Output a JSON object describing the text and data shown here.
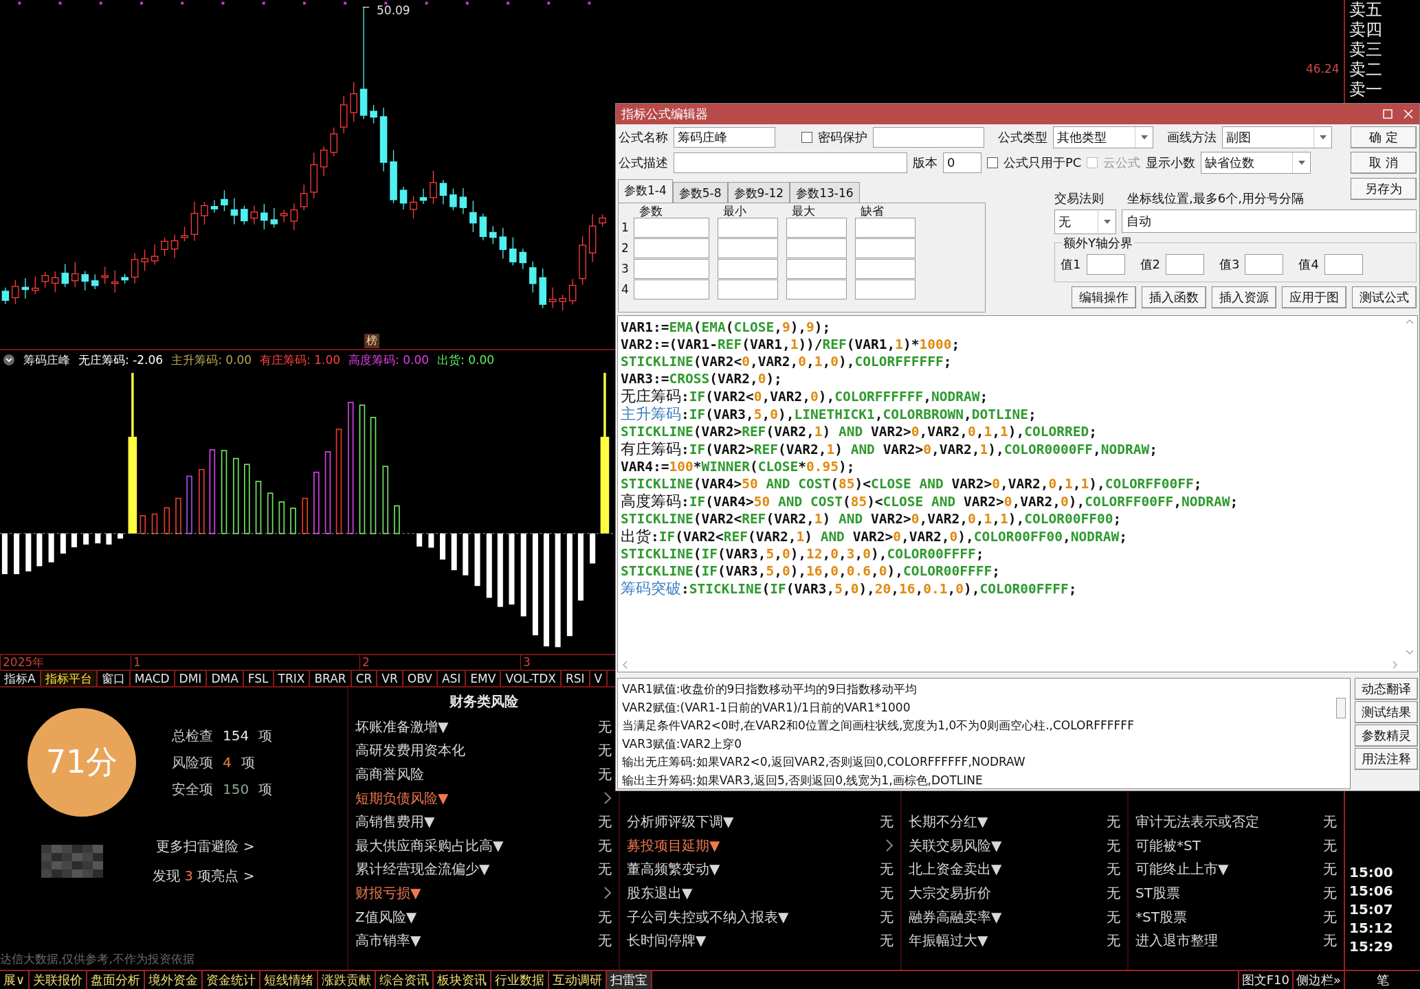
{
  "price_chart": {
    "high_label": "50.09",
    "price_label": "46.24",
    "marker": "榜"
  },
  "order_book": {
    "labels": [
      "卖五",
      "卖四",
      "卖三",
      "卖二",
      "卖一"
    ]
  },
  "indicator": {
    "name": "筹码庄峰",
    "values": [
      {
        "text": "无庄筹码: -2.06",
        "color": "#ffffff"
      },
      {
        "text": "主升筹码: 0.00",
        "color": "#b8a858"
      },
      {
        "text": "有庄筹码: 1.00",
        "color": "#ff4040"
      },
      {
        "text": "高度筹码: 0.00",
        "color": "#e040e8"
      },
      {
        "text": "出货: 0.00",
        "color": "#60f060"
      }
    ]
  },
  "time_axis": [
    "2025年",
    "1",
    "2",
    "3"
  ],
  "indicator_tabs": [
    {
      "label": "指标A",
      "selected": false
    },
    {
      "label": "指标平台",
      "selected": true
    },
    {
      "label": "窗口",
      "selected": false
    },
    {
      "label": "MACD",
      "selected": false
    },
    {
      "label": "DMI",
      "selected": false
    },
    {
      "label": "DMA",
      "selected": false
    },
    {
      "label": "FSL",
      "selected": false
    },
    {
      "label": "TRIX",
      "selected": false
    },
    {
      "label": "BRAR",
      "selected": false
    },
    {
      "label": "CR",
      "selected": false
    },
    {
      "label": "VR",
      "selected": false
    },
    {
      "label": "OBV",
      "selected": false
    },
    {
      "label": "ASI",
      "selected": false
    },
    {
      "label": "EMV",
      "selected": false
    },
    {
      "label": "VOL-TDX",
      "selected": false
    },
    {
      "label": "RSI",
      "selected": false
    },
    {
      "label": "V",
      "selected": false
    }
  ],
  "risk_summary": {
    "score": "71分",
    "stats": [
      {
        "label": "总检查",
        "count": "154",
        "unit": "项",
        "color": "#e8e8e8"
      },
      {
        "label": "风险项",
        "count": "4",
        "unit": "项",
        "color": "#f08040"
      },
      {
        "label": "安全项",
        "count": "150",
        "unit": "项",
        "color": "#8aa890"
      }
    ],
    "more_link": "更多扫雷避险 >",
    "highlights": {
      "before": "发现",
      "count": "3",
      "after": "项亮点 >"
    },
    "disclaimer": "达信大数据,仅供参考,不作为投资依据"
  },
  "risk_columns": [
    {
      "title": "财务类风险",
      "rows": [
        {
          "label": "坏账准备激增▼",
          "kind": "value",
          "value": "无"
        },
        {
          "label": "高研发费用资本化",
          "kind": "value",
          "value": "无"
        },
        {
          "label": "高商誉风险",
          "kind": "value",
          "value": "无"
        },
        {
          "label": "短期负债风险▼",
          "kind": "alert"
        },
        {
          "label": "高销售费用▼",
          "kind": "value",
          "value": "无"
        },
        {
          "label": "最大供应商采购占比高▼",
          "kind": "value",
          "value": "无"
        },
        {
          "label": "累计经营现金流偏少▼",
          "kind": "value",
          "value": "无"
        },
        {
          "label": "财报亏损▼",
          "kind": "alert"
        },
        {
          "label": "Z值风险▼",
          "kind": "value",
          "value": "无"
        },
        {
          "label": "高市销率▼",
          "kind": "value",
          "value": "无"
        }
      ]
    },
    {
      "rows": [
        {
          "label": "分析师评级下调▼",
          "kind": "value",
          "value": "无"
        },
        {
          "label": "募投项目延期▼",
          "kind": "alert"
        },
        {
          "label": "董高频繁变动▼",
          "kind": "value",
          "value": "无"
        },
        {
          "label": "股东退出▼",
          "kind": "value",
          "value": "无"
        },
        {
          "label": "子公司失控或不纳入报表▼",
          "kind": "value",
          "value": "无"
        },
        {
          "label": "长时间停牌▼",
          "kind": "value",
          "value": "无"
        }
      ]
    },
    {
      "rows": [
        {
          "label": "长期不分红▼",
          "kind": "value",
          "value": "无"
        },
        {
          "label": "关联交易风险▼",
          "kind": "value",
          "value": "无"
        },
        {
          "label": "北上资金卖出▼",
          "kind": "value",
          "value": "无"
        },
        {
          "label": "大宗交易折价",
          "kind": "value",
          "value": "无"
        },
        {
          "label": "融券高融卖率▼",
          "kind": "value",
          "value": "无"
        },
        {
          "label": "年振幅过大▼",
          "kind": "value",
          "value": "无"
        }
      ]
    },
    {
      "rows": [
        {
          "label": "审计无法表示或否定",
          "kind": "value",
          "value": "无"
        },
        {
          "label": "可能被*ST",
          "kind": "value",
          "value": "无"
        },
        {
          "label": "可能终止上市▼",
          "kind": "value",
          "value": "无"
        },
        {
          "label": "ST股票",
          "kind": "value",
          "value": "无"
        },
        {
          "label": "*ST股票",
          "kind": "value",
          "value": "无"
        },
        {
          "label": "进入退市整理",
          "kind": "value",
          "value": "无"
        }
      ]
    }
  ],
  "times": [
    "15:00",
    "15:06",
    "15:07",
    "15:12",
    "15:29"
  ],
  "bottom_tabs": [
    {
      "label": "展∨",
      "selected": false
    },
    {
      "label": "关联报价",
      "selected": false
    },
    {
      "label": "盘面分析",
      "selected": false
    },
    {
      "label": "境外资金",
      "selected": false
    },
    {
      "label": "资金统计",
      "selected": false
    },
    {
      "label": "短线情绪",
      "selected": false
    },
    {
      "label": "涨跌贡献",
      "selected": false
    },
    {
      "label": "综合资讯",
      "selected": false
    },
    {
      "label": "板块资讯",
      "selected": false
    },
    {
      "label": "行业数据",
      "selected": false
    },
    {
      "label": "互动调研",
      "selected": false
    },
    {
      "label": "扫雷宝",
      "selected": true
    }
  ],
  "bottom_right": [
    "图文F10",
    "侧边栏»"
  ],
  "pen_label": "笔",
  "editor": {
    "title": "指标公式编辑器",
    "name_label": "公式名称",
    "name_value": "筹码庄峰",
    "password": {
      "label": "密码保护",
      "checked": false,
      "disabled": false
    },
    "type_label": "公式类型",
    "type_value": "其他类型",
    "draw_label": "画线方法",
    "draw_value": "副图",
    "desc_label": "公式描述",
    "version_label": "版本",
    "version_value": "0",
    "pc_only": {
      "label": "公式只用于PC",
      "checked": false,
      "disabled": false
    },
    "cloud": {
      "label": "云公式",
      "checked": false,
      "disabled": true
    },
    "decimals_label": "显示小数",
    "decimals_value": "缺省位数",
    "side_buttons": [
      "确  定",
      "取  消",
      "另存为"
    ],
    "param_tabs": [
      {
        "label": "参数1-4",
        "selected": true
      },
      {
        "label": "参数5-8",
        "selected": false
      },
      {
        "label": "参数9-12",
        "selected": false
      },
      {
        "label": "参数13-16",
        "selected": false
      }
    ],
    "param_headers": [
      "参数",
      "最小",
      "最大",
      "缺省"
    ],
    "param_rows": [
      "1",
      "2",
      "3",
      "4"
    ],
    "trade_label": "交易法则",
    "trade_value": "无",
    "axis_label": "坐标线位置,最多6个,用分号分隔",
    "axis_value": "自动",
    "y_group": "额外Y轴分界",
    "y_values": [
      "值1",
      "值2",
      "值3",
      "值4"
    ],
    "actions": [
      "编辑操作",
      "插入函数",
      "插入资源",
      "应用于图",
      "测试公式"
    ],
    "code_lines": [
      {
        "body": "VAR1:=EMA(EMA(CLOSE,9),9);"
      },
      {
        "body": "VAR2:=(VAR1-REF(VAR1,1))/REF(VAR1,1)*1000;"
      },
      {
        "body": "STICKLINE(VAR2<0,VAR2,0,1,0),COLORFFFFFF;"
      },
      {
        "body": "VAR3:=CROSS(VAR2,0);"
      },
      {
        "name": "无庄筹码",
        "body": ":IF(VAR2<0,VAR2,0),COLORFFFFFF,NODRAW;"
      },
      {
        "name": "主升筹码",
        "color": "#3a7fc0",
        "body": ":IF(VAR3,5,0),LINETHICK1,COLORBROWN,DOTLINE;"
      },
      {
        "body": "STICKLINE(VAR2>REF(VAR2,1) AND VAR2>0,VAR2,0,1,1),COLORRED;"
      },
      {
        "name": "有庄筹码",
        "body": ":IF(VAR2>REF(VAR2,1) AND VAR2>0,VAR2,1),COLOR0000FF,NODRAW;"
      },
      {
        "body": "VAR4:=100*WINNER(CLOSE*0.95);"
      },
      {
        "body": "STICKLINE(VAR4>50 AND COST(85)<CLOSE AND VAR2>0,VAR2,0,1,1),COLORFF00FF;"
      },
      {
        "name": "高度筹码",
        "body": ":IF(VAR4>50 AND COST(85)<CLOSE AND VAR2>0,VAR2,0),COLORFF00FF,NODRAW;"
      },
      {
        "body": "STICKLINE(VAR2<REF(VAR2,1) AND VAR2>0,VAR2,0,1,1),COLOR00FF00;"
      },
      {
        "name": "出货",
        "body": ":IF(VAR2<REF(VAR2,1) AND VAR2>0,VAR2,0),COLOR00FF00,NODRAW;"
      },
      {
        "body": "STICKLINE(IF(VAR3,5,0),12,0,3,0),COLOR00FFFF;"
      },
      {
        "body": "STICKLINE(IF(VAR3,5,0),16,0,0.6,0),COLOR00FFFF;"
      },
      {
        "name": "筹码突破",
        "color": "#3a7fc0",
        "body": ":STICKLINE(IF(VAR3,5,0),20,16,0.1,0),COLOR00FFFF;"
      }
    ],
    "notes": [
      "VAR1赋值:收盘价的9日指数移动平均的9日指数移动平均",
      "VAR2赋值:(VAR1-1日前的VAR1)/1日前的VAR1*1000",
      "当满足条件VAR2<0时,在VAR2和0位置之间画柱状线,宽度为1,0不为0则画空心柱.,COLORFFFFFF",
      "VAR3赋值:VAR2上穿0",
      "输出无庄筹码:如果VAR2<0,返回VAR2,否则返回0,COLORFFFFFF,NODRAW",
      "输出主升筹码:如果VAR3,返回5,否则返回0,线宽为1,画棕色,DOTLINE"
    ],
    "note_buttons": [
      "动态翻译",
      "测试结果",
      "参数精灵",
      "用法注释"
    ]
  }
}
